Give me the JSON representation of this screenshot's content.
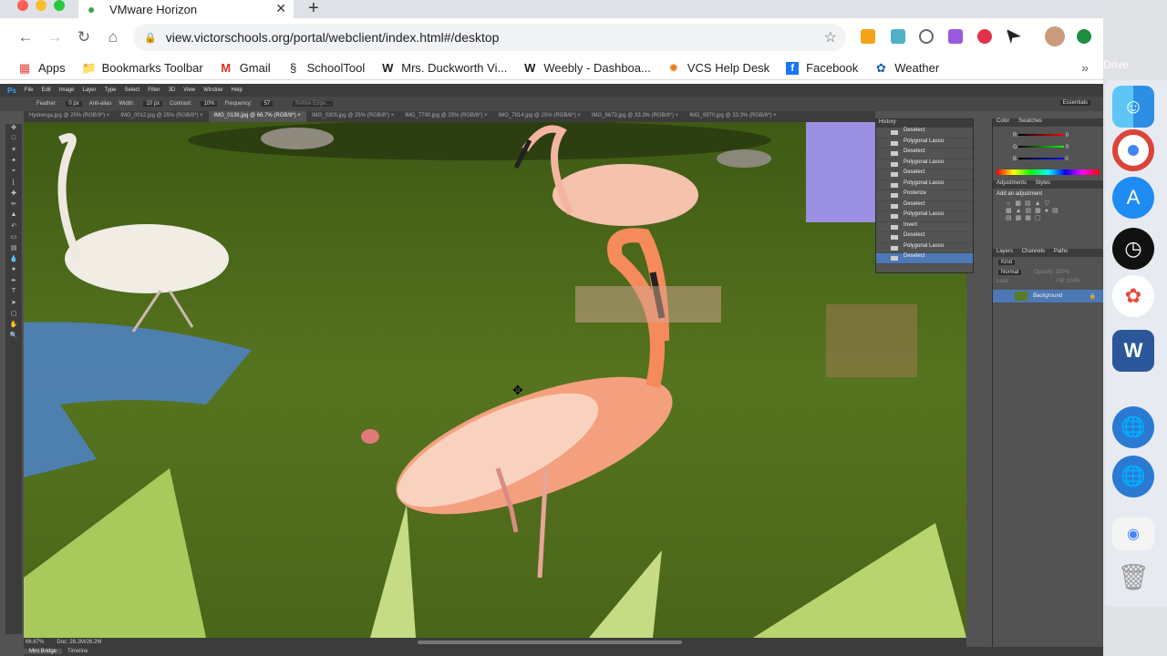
{
  "browser": {
    "tab_title": "VMware Horizon",
    "url": "view.victorschools.org/portal/webclient/index.html#/desktop"
  },
  "bookmarks": [
    "Apps",
    "Bookmarks Toolbar",
    "Gmail",
    "SchoolTool",
    "Mrs. Duckworth Vi...",
    "Weebly - Dashboa...",
    "VCS Help Desk",
    "Facebook",
    "Weather"
  ],
  "desktop": {
    "drive_label": "Drive"
  },
  "photoshop": {
    "logo": "Ps",
    "menu": [
      "File",
      "Edit",
      "Image",
      "Layer",
      "Type",
      "Select",
      "Filter",
      "3D",
      "View",
      "Window",
      "Help"
    ],
    "options": {
      "feather_label": "Feather:",
      "feather_value": "0 px",
      "antialias": "Anti-alias",
      "width_label": "Width:",
      "width_value": "10 px",
      "contrast_label": "Contrast:",
      "contrast_value": "10%",
      "frequency_label": "Frequency:",
      "frequency_value": "57",
      "refine": "Refine Edge...",
      "workspace": "Essentials"
    },
    "doc_tabs": [
      "Hydrenga.jpg @ 25% (RGB/8*) ×",
      "IMG_0012.jpg @ 25% (RGB/8*) ×",
      "IMG_0138.jpg @ 66.7% (RGB/8*) ×",
      "IMG_0305.jpg @ 25% (RGB/8*) ×",
      "IMG_7790.jpg @ 25% (RGB/8*) ×",
      "IMG_7814.jpg @ 25% (RGB/8*) ×",
      "IMG_8673.jpg @ 33.3% (RGB/8*) ×",
      "IMG_9970.jpg @ 33.3% (RGB/8*) ×"
    ],
    "active_tab_index": 2,
    "history": {
      "title": "History",
      "items": [
        "Deselect",
        "Polygonal Lasso",
        "Deselect",
        "Polygonal Lasso",
        "Deselect",
        "Polygonal Lasso",
        "Posterize",
        "Deselect",
        "Polygonal Lasso",
        "Invert",
        "Deselect",
        "Polygonal Lasso",
        "Deselect"
      ],
      "selected_index": 12
    },
    "color_panel": {
      "tabs": [
        "Color",
        "Swatches"
      ],
      "r": "0",
      "g": "0",
      "b": "0",
      "r_label": "R",
      "g_label": "G",
      "b_label": "B"
    },
    "adjustments": {
      "tabs": [
        "Adjustments",
        "Styles"
      ],
      "title": "Add an adjustment"
    },
    "layers": {
      "tabs": [
        "Layers",
        "Channels",
        "Paths"
      ],
      "kind": "Kind",
      "blend": "Normal",
      "opacity_label": "Opacity:",
      "opacity": "100%",
      "lock_label": "Lock:",
      "fill_label": "Fill:",
      "fill": "100%",
      "items": [
        "Background"
      ]
    },
    "status": {
      "zoom": "66.67%",
      "doc": "Doc: 26.2M/26.2M"
    },
    "bottom_tabs": [
      "Mini Bridge",
      "Timeline"
    ]
  },
  "colors": {
    "accent": "#4c78b5",
    "ps_dark": "#3c3c3c",
    "ps_panel": "#535353",
    "water": "#4d6a1c"
  }
}
